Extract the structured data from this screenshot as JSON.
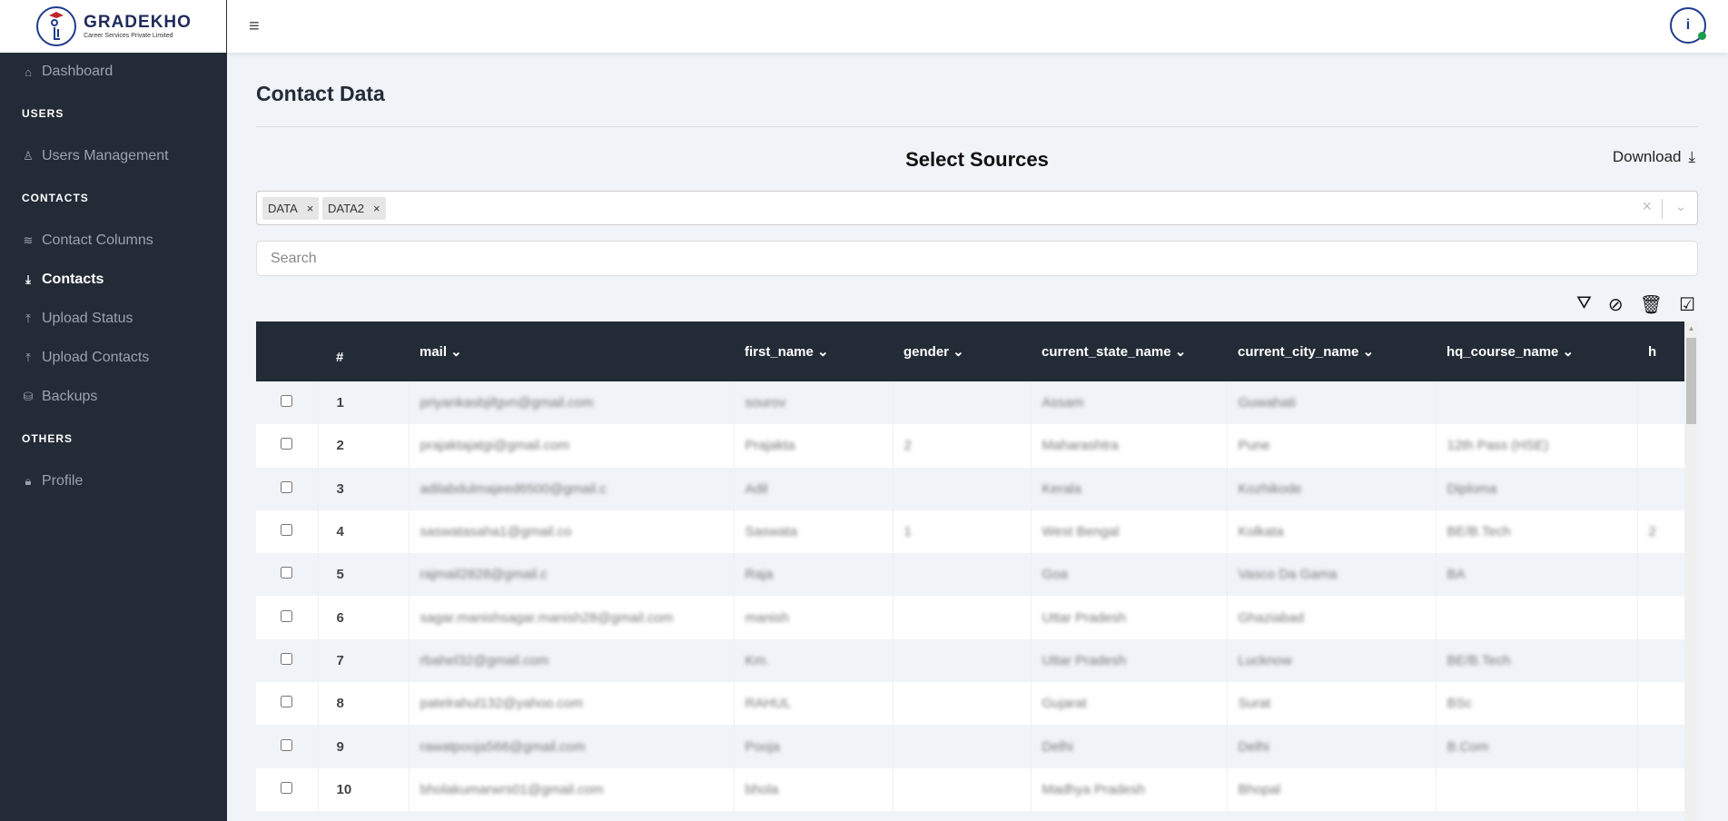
{
  "brand": {
    "name": "GRADEKHO",
    "tagline": "Career Services Private Limited"
  },
  "sidebar": {
    "dashboard": "Dashboard",
    "sections": [
      "USERS",
      "CONTACTS",
      "OTHERS"
    ],
    "items": [
      {
        "label": "Users Management",
        "icon": "user-icon"
      },
      {
        "label": "Contact Columns",
        "icon": "layers-icon"
      },
      {
        "label": "Contacts",
        "icon": "download-icon",
        "active": true
      },
      {
        "label": "Upload Status",
        "icon": "upload-icon"
      },
      {
        "label": "Upload Contacts",
        "icon": "upload-icon"
      },
      {
        "label": "Backups",
        "icon": "database-icon"
      },
      {
        "label": "Profile",
        "icon": "lock-icon"
      }
    ]
  },
  "page": {
    "title": "Contact Data",
    "select_title": "Select Sources",
    "download": "Download"
  },
  "sources": {
    "selected": [
      "DATA",
      "DATA2"
    ]
  },
  "search": {
    "placeholder": "Search",
    "value": ""
  },
  "table": {
    "columns": [
      "#",
      "mail",
      "first_name",
      "gender",
      "current_state_name",
      "current_city_name",
      "hq_course_name",
      "h"
    ],
    "rows": [
      [
        "1",
        "priyankasbjifgvn@gmail.com",
        "sourov",
        "",
        "Assam",
        "Guwahati",
        "",
        ""
      ],
      [
        "2",
        "prajaktajatgi@gmail.com",
        "Prajakta",
        "2",
        "Maharashtra",
        "Pune",
        "12th Pass (HSE)",
        ""
      ],
      [
        "3",
        "adilabdulmajeed6500@gmail.c",
        "Adil",
        "",
        "Kerala",
        "Kozhikode",
        "Diploma",
        ""
      ],
      [
        "4",
        "saswatasaha1@gmail.co",
        "Saswata",
        "1",
        "West Bengal",
        "Kolkata",
        "BE/B.Tech",
        "2"
      ],
      [
        "5",
        "rajmail2828@gmail.c",
        "Raja",
        "",
        "Goa",
        "Vasco Da Gama",
        "BA",
        ""
      ],
      [
        "6",
        "sagar.manishsagar.manish28@gmail.com",
        "manish",
        "",
        "Uttar Pradesh",
        "Ghaziabad",
        "",
        ""
      ],
      [
        "7",
        "rbahel32@gmail.com",
        "Km.",
        "",
        "Uttar Pradesh",
        "Lucknow",
        "BE/B.Tech",
        ""
      ],
      [
        "8",
        "patelrahul132@yahoo.com",
        "RAHUL",
        "",
        "Gujarat",
        "Surat",
        "BSc",
        ""
      ],
      [
        "9",
        "rawatpooja566@gmail.com",
        "Pooja",
        "",
        "Delhi",
        "Delhi",
        "B.Com",
        ""
      ],
      [
        "10",
        "bholakumarwrs01@gmail.com",
        "bhola",
        "",
        "Madhya Pradesh",
        "Bhopal",
        "",
        ""
      ]
    ]
  },
  "colors": {
    "sidebar": "#222b36",
    "table_header": "#222b36",
    "background": "#f0f3f8"
  }
}
